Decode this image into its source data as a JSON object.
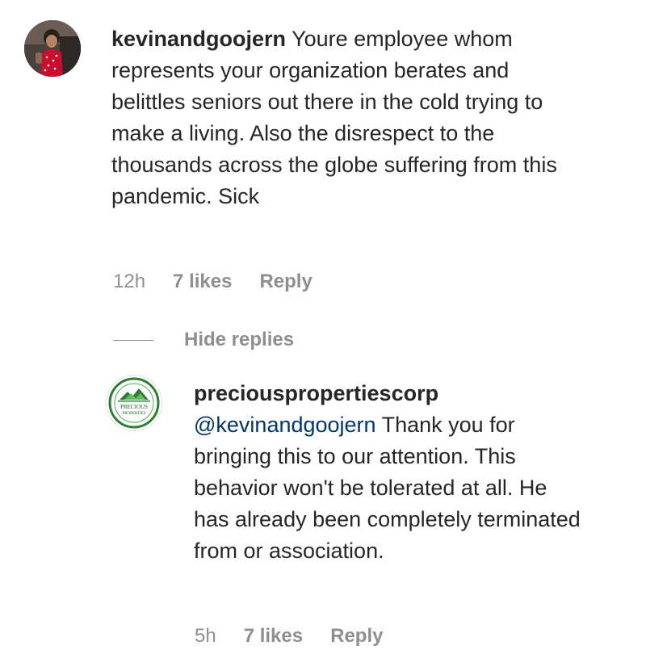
{
  "comments": [
    {
      "username": "kevinandgoojern",
      "text": "Youre employee whom represents your organization berates and belittles seniors out there in the cold trying to make a living. Also the disrespect to the thousands across the globe suffering from this pandemic. Sick",
      "time": "12h",
      "likes": "7 likes",
      "reply_label": "Reply",
      "avatar_icon": "child-photo-avatar"
    }
  ],
  "thread": {
    "hide_replies_label": "Hide replies"
  },
  "replies": [
    {
      "username": "preciouspropertiescorp",
      "mention": "@kevinandgoojern",
      "text": "Thank you for bringing this to our attention. This behavior won't be tolerated at all. He has already been completely terminated from or association.",
      "time": "5h",
      "likes": "7 likes",
      "reply_label": "Reply",
      "avatar_icon": "precious-properties-logo",
      "logo_text": "PRECIOUS PROPERTIES"
    }
  ],
  "colors": {
    "text": "#262626",
    "meta": "#8e8e8e",
    "mention": "#00376b",
    "logo_green": "#2e7d32"
  }
}
